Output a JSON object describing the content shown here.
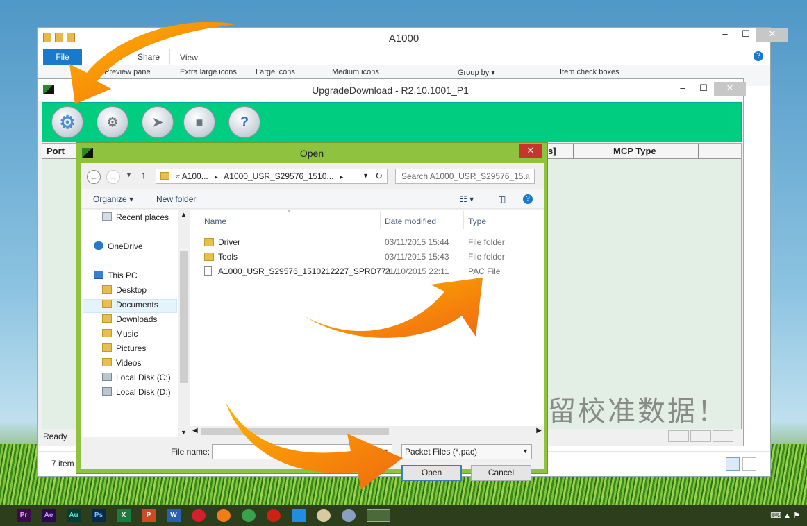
{
  "explorer": {
    "title": "A1000",
    "tabs": {
      "file": "File",
      "share": "Share",
      "view": "View"
    },
    "ribbon": {
      "preview_pane": "Preview pane",
      "extra_large_icons": "Extra large icons",
      "large_icons": "Large icons",
      "medium_icons": "Medium icons",
      "group_by": "Group by ▾",
      "item_check_boxes": "Item check boxes"
    },
    "status_items": "7 item"
  },
  "upgrade": {
    "title": "UpgradeDownload - R2.10.1001_P1",
    "columns": {
      "port": "Port",
      "s_fragment": "s]",
      "mcp_type": "MCP Type"
    },
    "status": "Ready"
  },
  "dialog": {
    "title": "Open",
    "address": {
      "prefix": "«",
      "crumb1": "A100...",
      "crumb2": "A1000_USR_S29576_1510..."
    },
    "search_placeholder": "Search A1000_USR_S29576_15...",
    "organize": "Organize ▾",
    "new_folder": "New folder",
    "nav_items": [
      "Recent places",
      "OneDrive",
      "This PC",
      "Desktop",
      "Documents",
      "Downloads",
      "Music",
      "Pictures",
      "Videos",
      "Local Disk (C:)",
      "Local Disk (D:)"
    ],
    "columns": {
      "name": "Name",
      "date": "Date modified",
      "type": "Type"
    },
    "files": [
      {
        "name": "Driver",
        "date": "03/11/2015 15:44",
        "type": "File folder"
      },
      {
        "name": "Tools",
        "date": "03/11/2015 15:43",
        "type": "File folder"
      },
      {
        "name": "A1000_USR_S29576_1510212227_SPRD773...",
        "date": "21/10/2015 22:11",
        "type": "PAC File"
      }
    ],
    "file_name_label": "File name:",
    "file_type": "Packet Files (*.pac)",
    "open_label": "Open",
    "cancel_label": "Cancel"
  },
  "watermark": "留校准数据！",
  "taskbar_apps": [
    "Pr",
    "Ae",
    "Au",
    "Ps",
    "X",
    "P",
    "W"
  ]
}
